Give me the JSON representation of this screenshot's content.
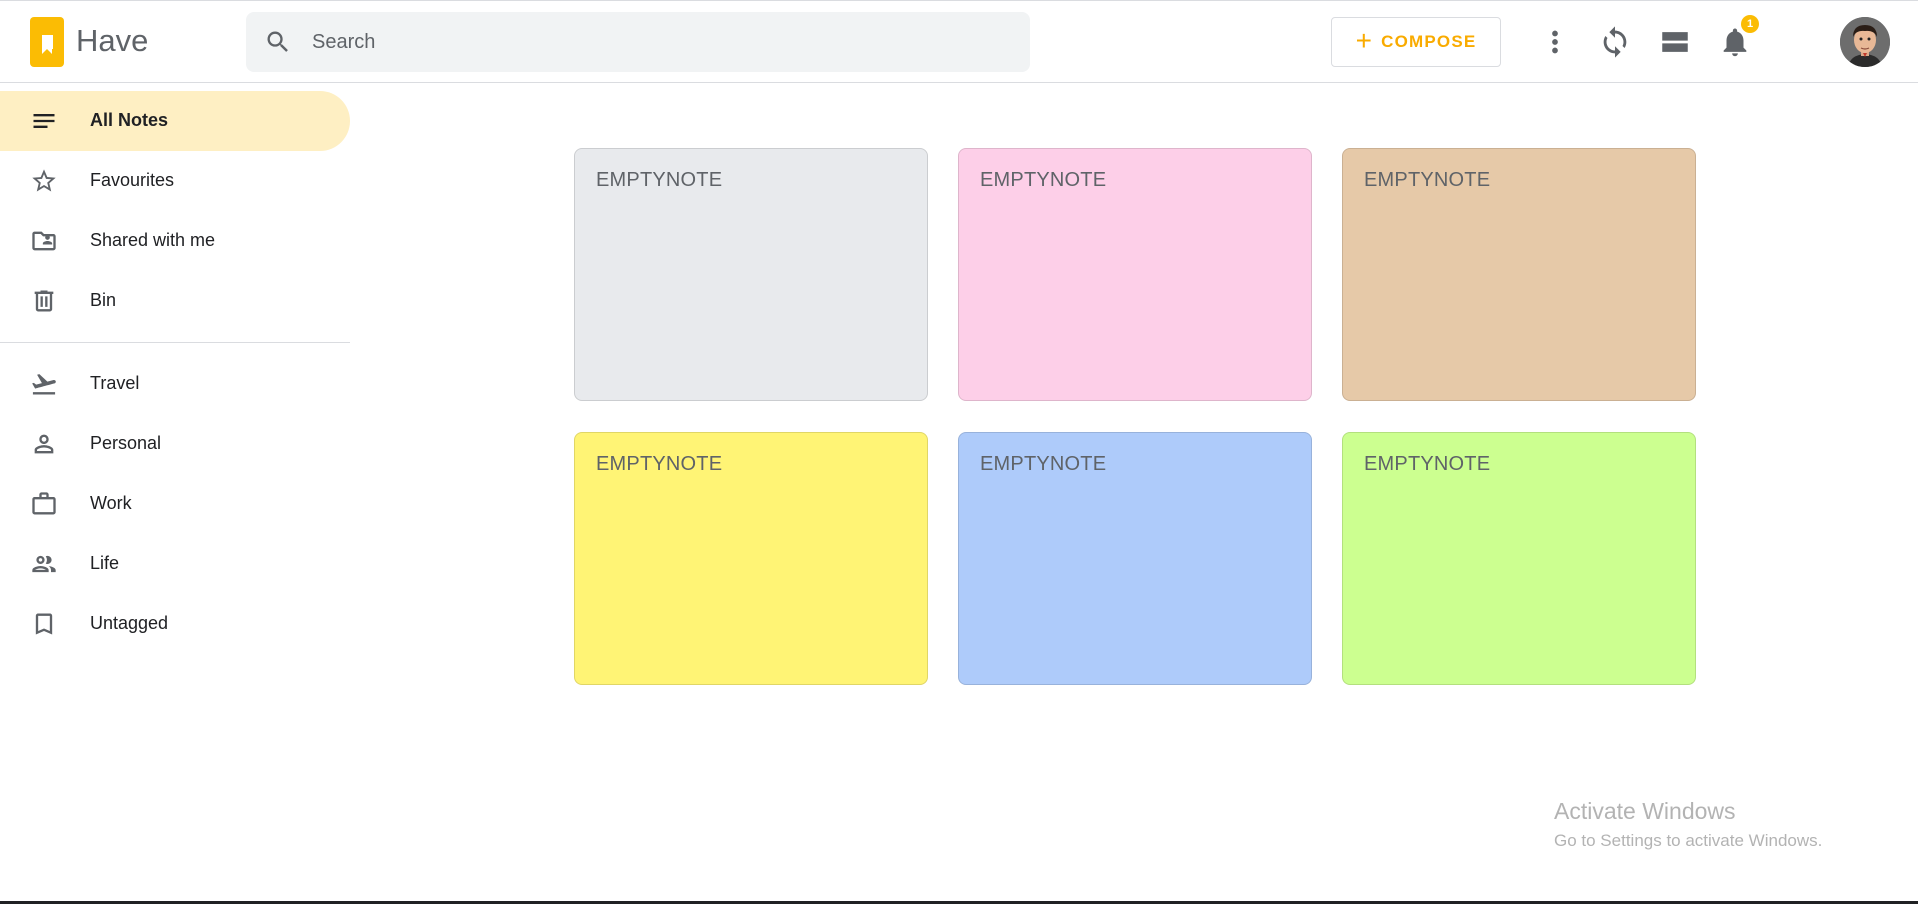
{
  "header": {
    "app_name": "Have",
    "search_placeholder": "Search",
    "compose_label": "COMPOSE",
    "notification_count": "1"
  },
  "sidebar": {
    "primary": [
      {
        "label": "All Notes",
        "icon": "menu-lines-icon",
        "active": true
      },
      {
        "label": "Favourites",
        "icon": "star-icon"
      },
      {
        "label": "Shared with me",
        "icon": "shared-folder-icon"
      },
      {
        "label": "Bin",
        "icon": "trash-icon"
      }
    ],
    "tags": [
      {
        "label": "Travel",
        "icon": "flight-icon"
      },
      {
        "label": "Personal",
        "icon": "person-icon"
      },
      {
        "label": "Work",
        "icon": "briefcase-icon"
      },
      {
        "label": "Life",
        "icon": "people-icon"
      },
      {
        "label": "Untagged",
        "icon": "bookmark-icon"
      }
    ]
  },
  "notes": [
    {
      "title": "EMPTYNOTE",
      "color": "#e8eaed"
    },
    {
      "title": "EMPTYNOTE",
      "color": "#fdcfe8"
    },
    {
      "title": "EMPTYNOTE",
      "color": "#e6c9a8"
    },
    {
      "title": "EMPTYNOTE",
      "color": "#fff475"
    },
    {
      "title": "EMPTYNOTE",
      "color": "#aecbfa"
    },
    {
      "title": "EMPTYNOTE",
      "color": "#ccff90"
    }
  ],
  "watermark": {
    "line1": "Activate Windows",
    "line2": "Go to Settings to activate Windows."
  },
  "colors": {
    "accent": "#fbbc04",
    "compose_text": "#f9ab00",
    "active_nav_bg": "#feefc3"
  }
}
